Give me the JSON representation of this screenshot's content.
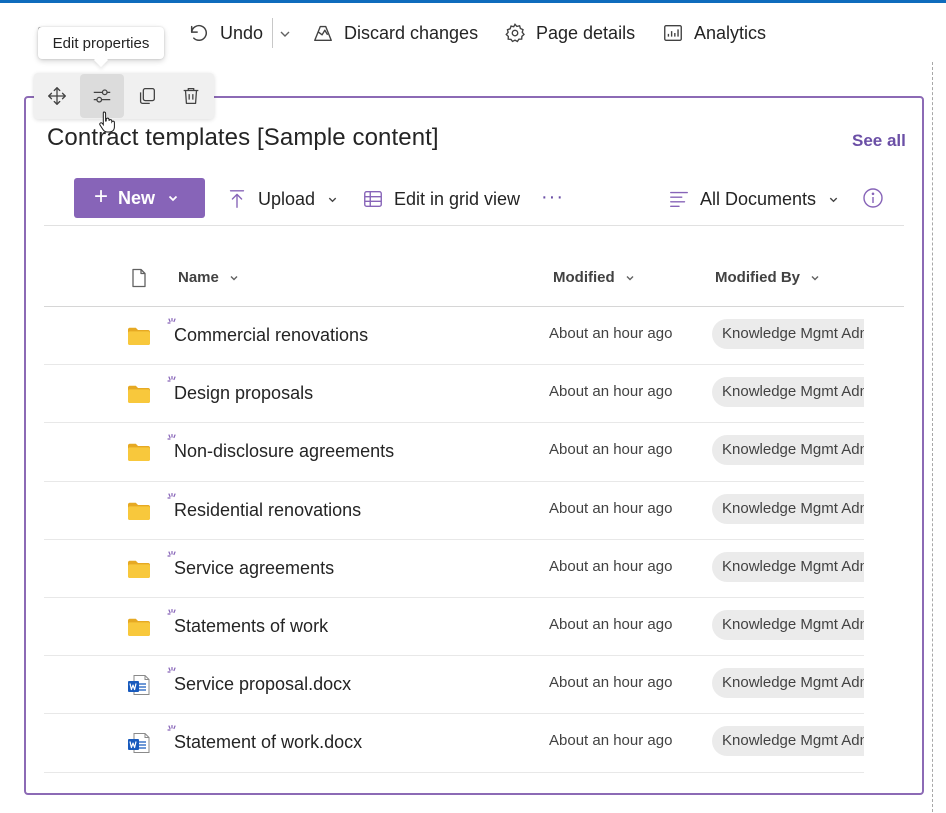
{
  "command_bar": {
    "undo_label": "Undo",
    "discard_label": "Discard changes",
    "page_details_label": "Page details",
    "analytics_label": "Analytics"
  },
  "tooltip": {
    "text": "Edit properties"
  },
  "webpart_toolbar": {
    "buttons": [
      {
        "name": "move",
        "icon": "move-icon"
      },
      {
        "name": "edit-properties",
        "icon": "sliders-icon",
        "active": true
      },
      {
        "name": "duplicate",
        "icon": "copy-icon"
      },
      {
        "name": "delete",
        "icon": "trash-icon"
      }
    ]
  },
  "library": {
    "title": "Contract templates [Sample content]",
    "see_all": "See all",
    "new_label": "New",
    "upload_label": "Upload",
    "grid_view_label": "Edit in grid view",
    "more_label": "···",
    "view_label": "All Documents",
    "columns": {
      "name": "Name",
      "modified": "Modified",
      "modified_by": "Modified By"
    },
    "rows": [
      {
        "type": "folder",
        "name": "Commercial renovations",
        "modified": "About an hour ago",
        "modified_by": "Knowledge Mgmt Admin"
      },
      {
        "type": "folder",
        "name": "Design proposals",
        "modified": "About an hour ago",
        "modified_by": "Knowledge Mgmt Admin"
      },
      {
        "type": "folder",
        "name": "Non-disclosure agreements",
        "modified": "About an hour ago",
        "modified_by": "Knowledge Mgmt Admin"
      },
      {
        "type": "folder",
        "name": "Residential renovations",
        "modified": "About an hour ago",
        "modified_by": "Knowledge Mgmt Admin"
      },
      {
        "type": "folder",
        "name": "Service agreements",
        "modified": "About an hour ago",
        "modified_by": "Knowledge Mgmt Admin"
      },
      {
        "type": "folder",
        "name": "Statements of work",
        "modified": "About an hour ago",
        "modified_by": "Knowledge Mgmt Admin"
      },
      {
        "type": "docx",
        "name": "Service proposal.docx",
        "modified": "About an hour ago",
        "modified_by": "Knowledge Mgmt Admin"
      },
      {
        "type": "docx",
        "name": "Statement of work.docx",
        "modified": "About an hour ago",
        "modified_by": "Knowledge Mgmt Admin"
      }
    ]
  },
  "colors": {
    "accent": "#8764b8",
    "frame": "#8c6ab5",
    "link": "#6b4fa6",
    "folder": "#f4c43a",
    "word": "#185abd"
  }
}
